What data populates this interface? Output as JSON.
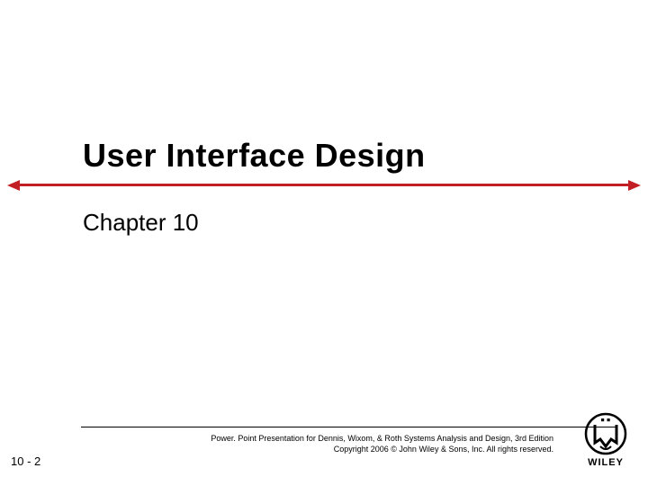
{
  "slide": {
    "title": "User Interface Design",
    "subtitle": "Chapter 10",
    "number": "10 - 2"
  },
  "footer": {
    "line1": "Power. Point Presentation for Dennis, Wixom, & Roth Systems Analysis and Design, 3rd Edition",
    "line2": "Copyright 2006 © John Wiley & Sons, Inc.  All rights reserved."
  },
  "logo": {
    "brand": "WILEY"
  },
  "colors": {
    "accent_red": "#c21f24"
  }
}
